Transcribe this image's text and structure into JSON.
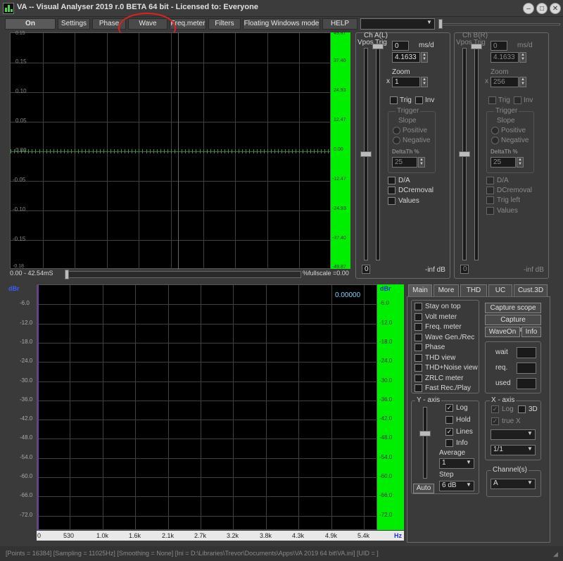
{
  "window": {
    "title": "VA -- Visual Analyser 2019 r.0 BETA 64 bit - Licensed to: Everyone"
  },
  "toolbar": {
    "buttons": [
      "On",
      "Settings",
      "Phase",
      "Wave",
      "Freq.meter",
      "Filters",
      "Floating Windows mode",
      "HELP"
    ],
    "combo_value": ""
  },
  "scope": {
    "y_ticks": [
      "0.15",
      "0.10",
      "0.05",
      "0.00",
      "-0.05",
      "-0.10",
      "-0.15"
    ],
    "y_top_partial": "0.15",
    "y_bottom_partial": "-0.18",
    "right_ticks": [
      "37.40",
      "24.93",
      "12.47",
      "0.00",
      "-12.47",
      "-24.93",
      "-37.40"
    ],
    "right_top_partial": "49.87",
    "right_bottom_partial": "-49.87",
    "time_range": "0.00 - 42.54mS",
    "fullscale": "%fullscale =0.00"
  },
  "chA": {
    "header": "Ch A(L)",
    "vpos": "Vpos",
    "trig": "Trig",
    "vpos_val": "0",
    "ms_label": "ms/d",
    "ms_val": "4.1633",
    "zoom_label": "Zoom",
    "zoom_x": "x",
    "zoom_val": "1",
    "trig_chk": "Trig",
    "inv_chk": "Inv",
    "trigger_group": "Trigger",
    "slope": "Slope",
    "positive": "Positive",
    "negative": "Negative",
    "delta": "DeltaTh %",
    "delta_val": "25",
    "da": "D/A",
    "dcremoval": "DCremoval",
    "values": "Values",
    "bottom_val": "0",
    "inf": "-inf dB"
  },
  "chB": {
    "header": "Ch B(R)",
    "vpos": "Vpos",
    "trig": "Trig",
    "vpos_val": "0",
    "ms_label": "ms/d",
    "ms_val": "4.1633",
    "zoom_label": "Zoom",
    "zoom_x": "x",
    "zoom_val": "256",
    "trig_chk": "Trig",
    "inv_chk": "Inv",
    "trigger_group": "Trigger",
    "slope": "Slope",
    "positive": "Positive",
    "negative": "Negative",
    "delta": "DeltaTh %",
    "delta_val": "25",
    "da": "D/A",
    "dcremoval": "DCremoval",
    "trig_left": "Trig left",
    "values": "Values",
    "bottom_val": "0",
    "inf": "-inf dB"
  },
  "spectrum": {
    "unit_left": "dBr",
    "unit_right": "dBr",
    "readout": "0.00000",
    "y_ticks": [
      "-6.0",
      "-12.0",
      "-18.0",
      "-24.0",
      "-30.0",
      "-36.0",
      "-42.0",
      "-48.0",
      "-54.0",
      "-60.0",
      "-66.0",
      "-72.0"
    ],
    "x_ticks": [
      "0",
      "530",
      "1.0k",
      "1.6k",
      "2.1k",
      "2.7k",
      "3.2k",
      "3.8k",
      "4.3k",
      "4.9k",
      "5.4k"
    ],
    "x_unit": "Hz"
  },
  "tabs": [
    "Main",
    "More",
    "THD",
    "UC",
    "Cust.3D"
  ],
  "main": {
    "checks": [
      "Stay on top",
      "Volt meter",
      "Freq. meter",
      "Wave Gen./Rec",
      "Phase",
      "THD view",
      "THD+Noise view",
      "ZRLC meter",
      "Fast Rec./Play"
    ],
    "capture_scope": "Capture scope",
    "capture_spectrum": "Capture spectrum",
    "waveon": "WaveOn",
    "info": "Info",
    "wait": "wait",
    "req": "req.",
    "used": "used"
  },
  "yaxis": {
    "title": "Y - axis",
    "log": "Log",
    "hold": "Hold",
    "lines": "Lines",
    "info": "Info",
    "average": "Average",
    "average_val": "1",
    "step": "Step",
    "step_val": "6 dB",
    "auto": "Auto"
  },
  "xaxis": {
    "title": "X - axis",
    "log": "Log",
    "three_d": "3D",
    "truex": "true X",
    "combo1": "",
    "ratio": "1/1"
  },
  "channels": {
    "title": "Channel(s)",
    "value": "A"
  },
  "status": {
    "text": "[Points = 16384]  [Sampling = 11025Hz]  [Smoothing = None]  [Ini = D:\\Libraries\\Trevor\\Documents\\Apps\\VA 2019 64 bit\\VA.ini]  [UID = ]"
  }
}
